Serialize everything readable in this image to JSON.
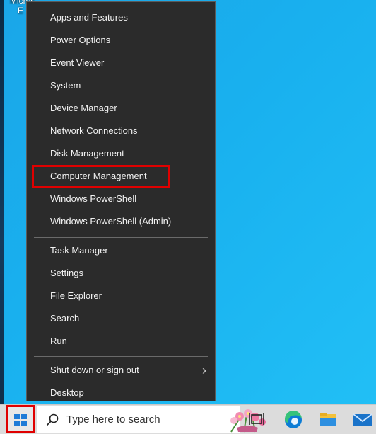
{
  "desktop": {
    "icon_label_line1": "Micros",
    "icon_label_line2": "E"
  },
  "menu": {
    "group1": [
      {
        "label": "Apps and Features"
      },
      {
        "label": "Power Options"
      },
      {
        "label": "Event Viewer"
      },
      {
        "label": "System"
      },
      {
        "label": "Device Manager"
      },
      {
        "label": "Network Connections"
      },
      {
        "label": "Disk Management"
      },
      {
        "label": "Computer Management",
        "highlighted": true
      },
      {
        "label": "Windows PowerShell"
      },
      {
        "label": "Windows PowerShell (Admin)"
      }
    ],
    "group2": [
      {
        "label": "Task Manager"
      },
      {
        "label": "Settings"
      },
      {
        "label": "File Explorer"
      },
      {
        "label": "Search"
      },
      {
        "label": "Run"
      }
    ],
    "group3": [
      {
        "label": "Shut down or sign out",
        "has_submenu": true
      },
      {
        "label": "Desktop"
      }
    ]
  },
  "taskbar": {
    "search_placeholder": "Type here to search",
    "start_icon": "windows-logo-icon",
    "icons": [
      "task-view-icon",
      "edge-icon",
      "file-explorer-icon",
      "mail-icon"
    ]
  },
  "colors": {
    "menu_bg": "#2b2b2b",
    "highlight_border": "#e00000",
    "desktop_blue": "#1aa6e8"
  }
}
